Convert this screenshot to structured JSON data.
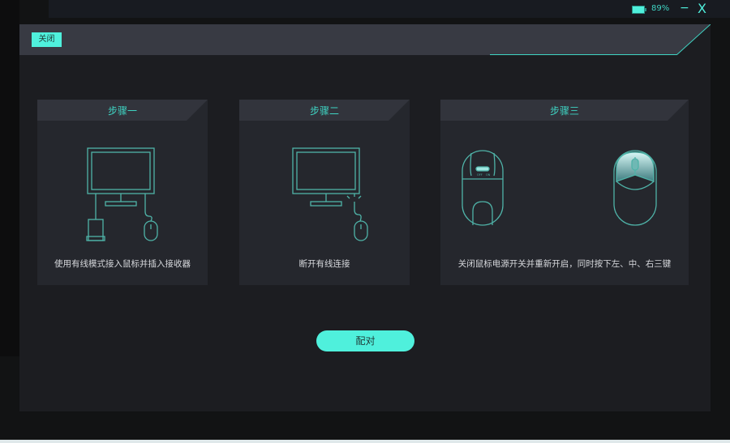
{
  "status": {
    "battery": "89%",
    "minimize": "−",
    "close": "X"
  },
  "header": {
    "close_label": "关闭"
  },
  "steps": [
    {
      "title": "步骤一",
      "description": "使用有线模式接入鼠标并插入接收器"
    },
    {
      "title": "步骤二",
      "description": "断开有线连接"
    },
    {
      "title": "步骤三",
      "description": "关闭鼠标电源开关并重新开启，同时按下左、中、右三键",
      "switch_off": "OFF",
      "switch_on": "ON"
    }
  ],
  "pair_button": "配对",
  "colors": {
    "accent": "#4ff0dc",
    "panel": "#1c1d21",
    "card": "#25272d"
  }
}
